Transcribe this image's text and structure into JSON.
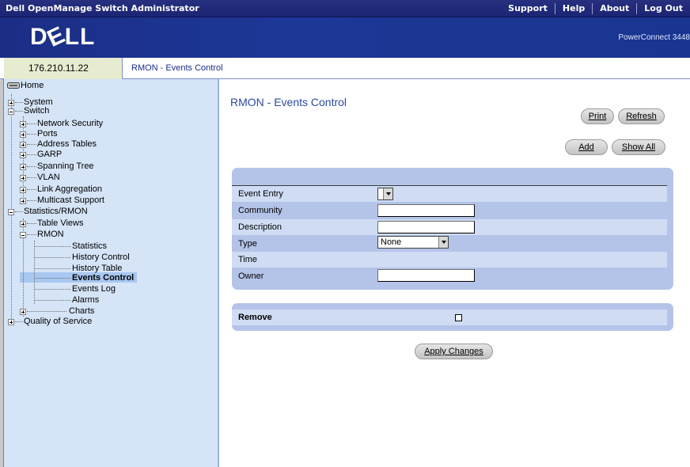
{
  "app": {
    "title": "Dell OpenManage Switch Administrator",
    "nav": [
      "Support",
      "Help",
      "About",
      "Log Out"
    ],
    "brand": "DELL",
    "model": "PowerConnect 3448"
  },
  "address": {
    "ip": "176.210.11.22",
    "breadcrumb": "RMON - Events Control"
  },
  "sidebar": {
    "home": "Home",
    "system": "System",
    "switch": "Switch",
    "network_security": "Network Security",
    "ports": "Ports",
    "address_tables": "Address Tables",
    "garp": "GARP",
    "spanning_tree": "Spanning Tree",
    "vlan": "VLAN",
    "link_aggregation": "Link Aggregation",
    "multicast_support": "Multicast Support",
    "statistics_rmon": "Statistics/RMON",
    "table_views": "Table Views",
    "rmon": "RMON",
    "statistics": "Statistics",
    "history_control": "History Control",
    "history_table": "History Table",
    "events_control": "Events Control",
    "events_log": "Events Log",
    "alarms": "Alarms",
    "charts": "Charts",
    "qos": "Quality of Service"
  },
  "main": {
    "title": "RMON - Events Control",
    "buttons": {
      "print": "Print",
      "refresh": "Refresh",
      "add": "Add",
      "show_all": "Show All",
      "apply": "Apply Changes"
    },
    "form": {
      "event_entry": "Event Entry",
      "community": "Community",
      "description": "Description",
      "type": "Type",
      "type_value": "None",
      "time": "Time",
      "owner": "Owner"
    },
    "remove": {
      "label": "Remove",
      "checked": false
    }
  },
  "colors": {
    "titlebar": "#1c2574",
    "banner": "#1b2e86",
    "sidebar": "#d5e4f7",
    "panel": "#b4c4e8",
    "heading": "#2b4aa4"
  }
}
